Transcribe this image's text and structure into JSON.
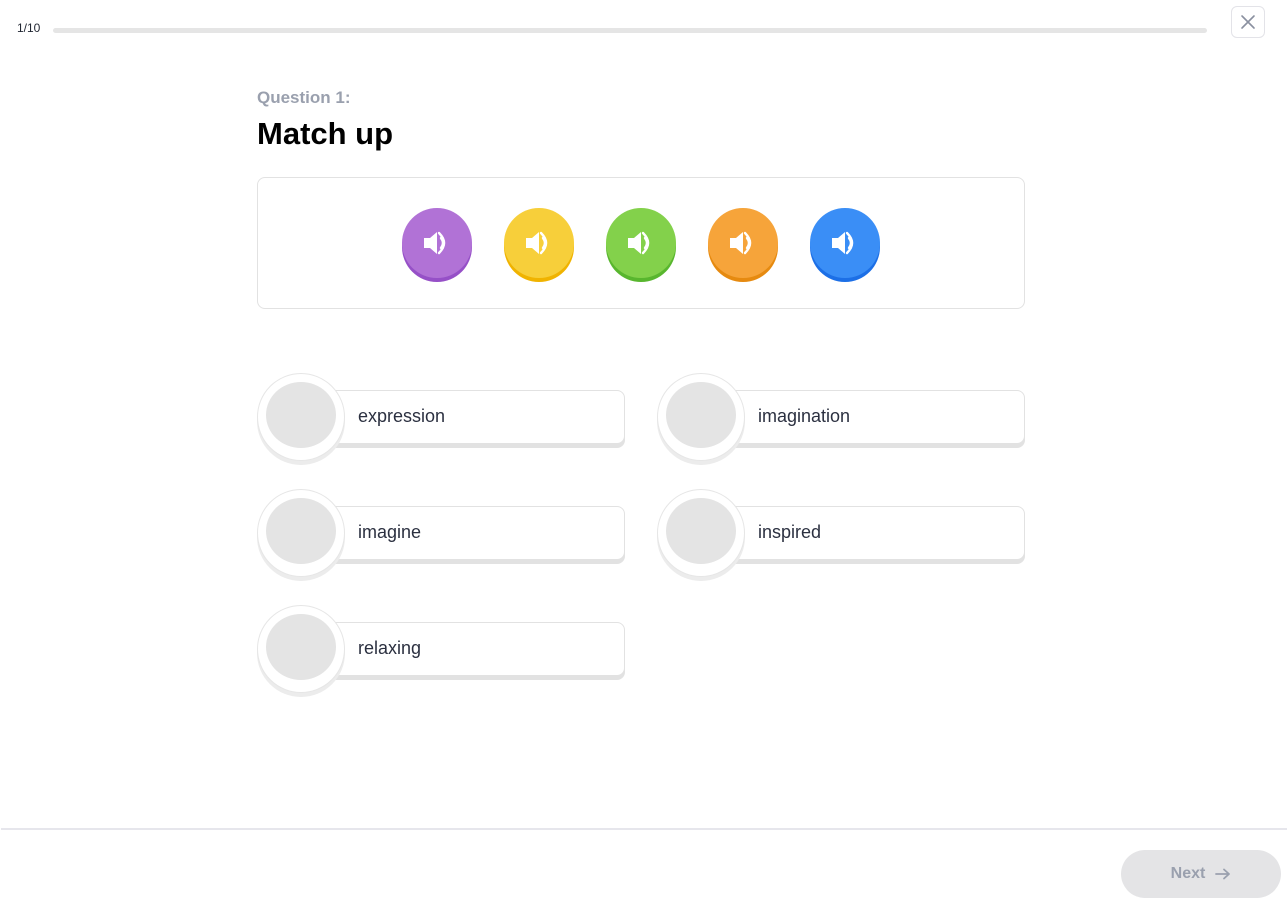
{
  "progress": {
    "label": "1/10",
    "current": 1,
    "total": 10,
    "fraction": 0
  },
  "close": {
    "icon": "close-icon"
  },
  "question": {
    "label": "Question 1:",
    "title": "Match up"
  },
  "audio_buttons": [
    {
      "name": "audio-1",
      "icon": "speaker-icon",
      "color": "#b172d6",
      "shadow": "#9650c7"
    },
    {
      "name": "audio-2",
      "icon": "speaker-icon",
      "color": "#f7cf3a",
      "shadow": "#f0b300"
    },
    {
      "name": "audio-3",
      "icon": "speaker-icon",
      "color": "#83d14b",
      "shadow": "#58b62e"
    },
    {
      "name": "audio-4",
      "icon": "speaker-icon",
      "color": "#f6a43a",
      "shadow": "#e68a10"
    },
    {
      "name": "audio-5",
      "icon": "speaker-icon",
      "color": "#3a8ef6",
      "shadow": "#1c6fe6"
    }
  ],
  "answers": [
    {
      "label": "expression"
    },
    {
      "label": "imagination"
    },
    {
      "label": "imagine"
    },
    {
      "label": "inspired"
    },
    {
      "label": "relaxing"
    }
  ],
  "footer": {
    "next_label": "Next",
    "next_icon": "arrow-right-icon"
  }
}
